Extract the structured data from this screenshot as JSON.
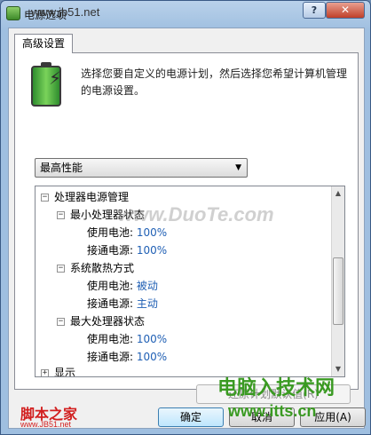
{
  "window": {
    "title": "电源选项",
    "help_label": "?",
    "close_label": "✕"
  },
  "tabs": [
    {
      "label": "高级设置"
    }
  ],
  "description": "选择您要自定义的电源计划，然后选择您希望计算机管理的电源设置。",
  "plan_select": {
    "value": "最高性能",
    "arrow": "▼"
  },
  "tree": {
    "items": [
      {
        "expander": "−",
        "label": "处理器电源管理"
      },
      {
        "expander": "−",
        "label": "最小处理器状态"
      },
      {
        "label": "使用电池:",
        "value": "100%"
      },
      {
        "label": "接通电源:",
        "value": "100%"
      },
      {
        "expander": "−",
        "label": "系统散热方式"
      },
      {
        "label": "使用电池:",
        "value": "被动"
      },
      {
        "label": "接通电源:",
        "value": "主动"
      },
      {
        "expander": "−",
        "label": "最大处理器状态"
      },
      {
        "label": "使用电池:",
        "value": "100%"
      },
      {
        "label": "接通电源:",
        "value": "100%"
      },
      {
        "expander": "+",
        "label": "显示"
      }
    ],
    "scroll_up": "▲",
    "scroll_down": "▼"
  },
  "buttons": {
    "restore": "还原计划默认值(R)",
    "ok": "确定",
    "cancel": "取消",
    "apply": "应用(A)"
  },
  "watermarks": {
    "top_url": "www.jb51.net",
    "center": "www.DuoTe.com",
    "brand_left": "脚本之家",
    "url_left": "www.JB51.net",
    "brand_right": "电脑入技术网",
    "url_right": "www.itts.cn"
  },
  "colors": {
    "value_blue": "#1f5fb4",
    "brand_red": "#d21f1f",
    "brand_green": "#3a9a22"
  }
}
